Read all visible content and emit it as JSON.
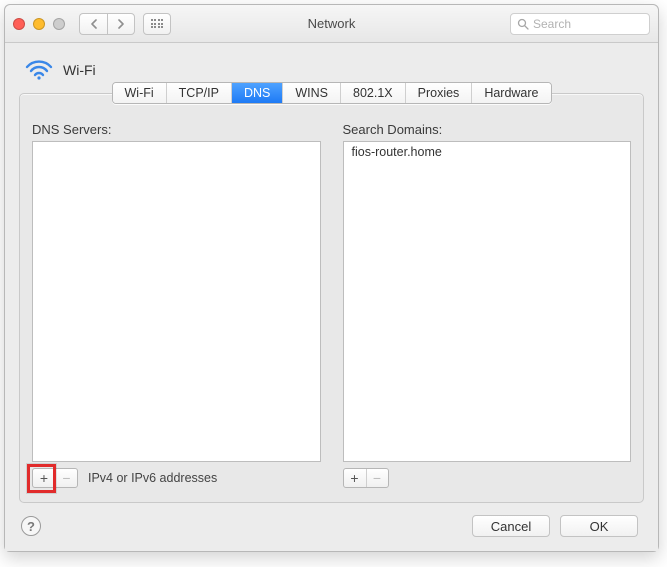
{
  "window": {
    "title": "Network"
  },
  "search": {
    "placeholder": "Search"
  },
  "adapter": {
    "name": "Wi-Fi"
  },
  "tabs": [
    {
      "label": "Wi-Fi"
    },
    {
      "label": "TCP/IP"
    },
    {
      "label": "DNS"
    },
    {
      "label": "WINS"
    },
    {
      "label": "802.1X"
    },
    {
      "label": "Proxies"
    },
    {
      "label": "Hardware"
    }
  ],
  "activeTab": "DNS",
  "dns": {
    "label": "DNS Servers:",
    "hint": "IPv4 or IPv6 addresses",
    "entries": [
      " "
    ]
  },
  "domains": {
    "label": "Search Domains:",
    "entries": [
      "fios-router.home"
    ]
  },
  "buttons": {
    "cancel": "Cancel",
    "ok": "OK"
  }
}
